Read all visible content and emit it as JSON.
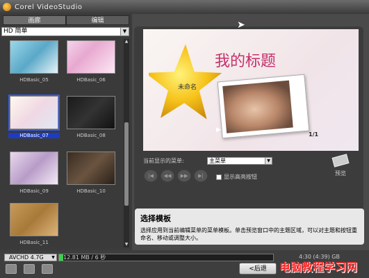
{
  "window": {
    "title": "Corel VideoStudio"
  },
  "left": {
    "tabs": [
      {
        "label": "画廊"
      },
      {
        "label": "编辑"
      }
    ],
    "menu_category": {
      "value": "HD 简单"
    },
    "thumbnails": [
      {
        "label": "HDBasic_05"
      },
      {
        "label": "HDBasic_06"
      },
      {
        "label": "HDBasic_07"
      },
      {
        "label": "HDBasic_08"
      },
      {
        "label": "HDBasic_09"
      },
      {
        "label": "HDBasic_10"
      },
      {
        "label": "HDBasic_11"
      }
    ]
  },
  "preview": {
    "title": "我的标题",
    "subtitle": "未命名",
    "page": "1/1",
    "menu_label": "当前显示的菜单:",
    "menu_value": "主菜单",
    "highlight_label": "显示高亮按钮",
    "preview_label": "预览"
  },
  "description": {
    "title": "选择模板",
    "text": "选择应用到当前编辑菜单的菜单模板。单击预览窗口中的主题区域，可以对主题和按钮重命名、移动或调整大小。"
  },
  "bottom": {
    "disc_type": "AVCHD 4.7G",
    "size_text": "12.81 MB / 6 秒",
    "time_text": "4:30 (4:39) GB",
    "back_label": "<后退",
    "usage_fraction": 0.02
  },
  "watermark": "电脑教程学习网",
  "colors": {
    "accent": "#1c3cc4",
    "title": "#c5306c",
    "progress": "#3ad24a"
  }
}
